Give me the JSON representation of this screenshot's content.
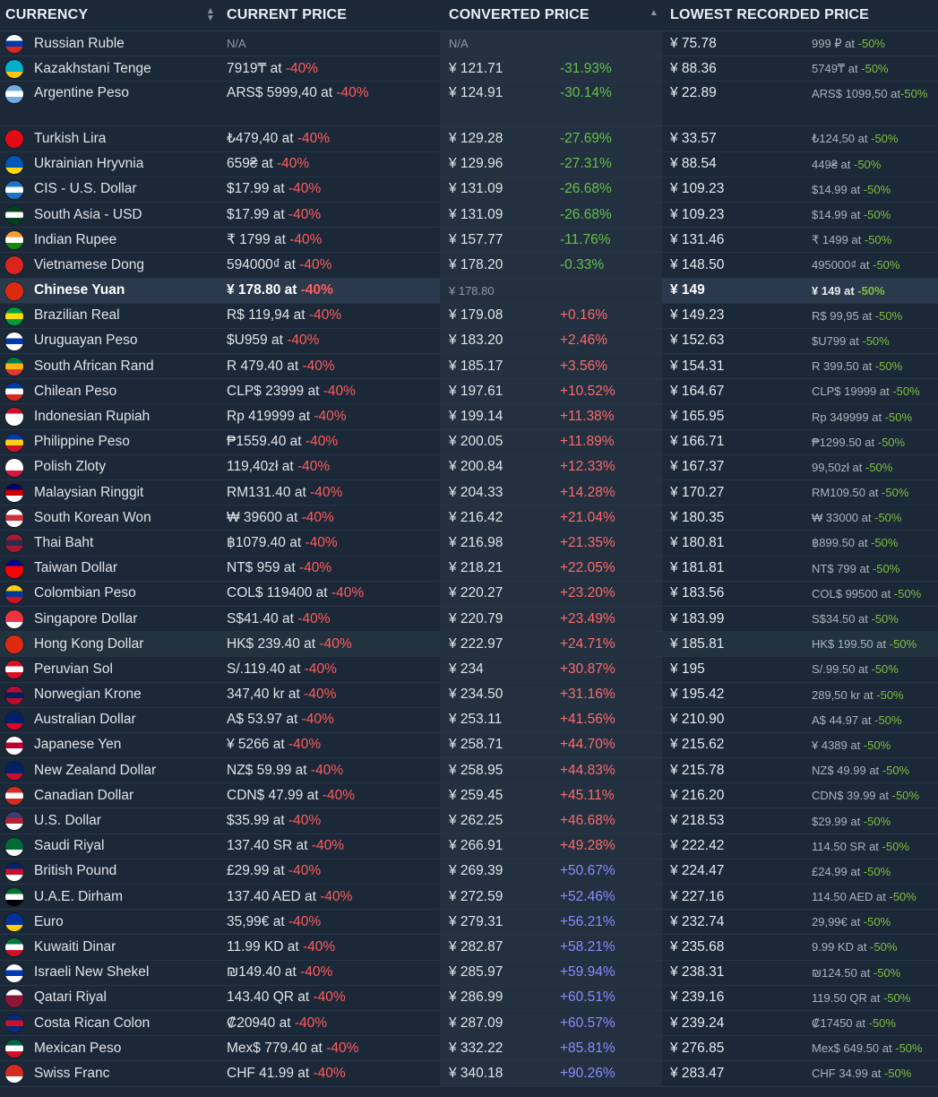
{
  "header": {
    "currency": "CURRENCY",
    "current_price": "CURRENT PRICE",
    "converted_price": "CONVERTED PRICE",
    "lowest_recorded_price": "LOWEST RECORDED PRICE"
  },
  "rows": [
    {
      "name": "Russian Ruble",
      "price": "N/A",
      "discount": "",
      "conv": "N/A",
      "pct": "",
      "low": "¥ 75.78",
      "low_sub": "999 ₽ at",
      "low_disc": "-50%",
      "flag": [
        "#ffffff",
        "#0039a6",
        "#d52b1e"
      ]
    },
    {
      "name": "Kazakhstani Tenge",
      "price": "7919₸ at",
      "discount": "-40%",
      "conv": "¥ 121.71",
      "pct": "-31.93%",
      "low": "¥ 88.36",
      "low_sub": "5749₸ at",
      "low_disc": "-50%",
      "flag": [
        "#00afca",
        "#00afca",
        "#fec50c"
      ]
    },
    {
      "name": "Argentine Peso",
      "price": "ARS$ 5999,40 at",
      "discount": "-40%",
      "conv": "¥ 124.91",
      "pct": "-30.14%",
      "low": "¥ 22.89",
      "low_sub": "ARS$ 1099,50 at",
      "low_disc": "-50%",
      "flag": [
        "#74acdf",
        "#ffffff",
        "#74acdf"
      ]
    },
    {
      "name": "Turkish Lira",
      "price": "₺479,40 at",
      "discount": "-40%",
      "conv": "¥ 129.28",
      "pct": "-27.69%",
      "low": "¥ 33.57",
      "low_sub": "₺124,50 at",
      "low_disc": "-50%",
      "flag": [
        "#e30a17",
        "#e30a17",
        "#e30a17"
      ]
    },
    {
      "name": "Ukrainian Hryvnia",
      "price": "659₴ at",
      "discount": "-40%",
      "conv": "¥ 129.96",
      "pct": "-27.31%",
      "low": "¥ 88.54",
      "low_sub": "449₴ at",
      "low_disc": "-50%",
      "flag": [
        "#0057b7",
        "#0057b7",
        "#ffd700"
      ]
    },
    {
      "name": "CIS - U.S. Dollar",
      "price": "$17.99 at",
      "discount": "-40%",
      "conv": "¥ 131.09",
      "pct": "-26.68%",
      "low": "¥ 109.23",
      "low_sub": "$14.99 at",
      "low_disc": "-50%",
      "flag": [
        "#1a73c9",
        "#ffffff",
        "#1a73c9"
      ]
    },
    {
      "name": "South Asia - USD",
      "price": "$17.99 at",
      "discount": "-40%",
      "conv": "¥ 131.09",
      "pct": "-26.68%",
      "low": "¥ 109.23",
      "low_sub": "$14.99 at",
      "low_disc": "-50%",
      "flag": [
        "#01411c",
        "#ffffff",
        "#01411c"
      ]
    },
    {
      "name": "Indian Rupee",
      "price": "₹ 1799 at",
      "discount": "-40%",
      "conv": "¥ 157.77",
      "pct": "-11.76%",
      "low": "¥ 131.46",
      "low_sub": "₹ 1499 at",
      "low_disc": "-50%",
      "flag": [
        "#ff9933",
        "#ffffff",
        "#138808"
      ]
    },
    {
      "name": "Vietnamese Dong",
      "price": "594000₫ at",
      "discount": "-40%",
      "conv": "¥ 178.20",
      "pct": "-0.33%",
      "low": "¥ 148.50",
      "low_sub": "495000₫ at",
      "low_disc": "-50%",
      "flag": [
        "#da251d",
        "#da251d",
        "#da251d"
      ]
    },
    {
      "name": "Chinese Yuan",
      "price": "¥ 178.80 at",
      "discount": "-40%",
      "conv": "¥ 178.80",
      "pct": "",
      "low": "¥ 149",
      "low_sub": "¥ 149 at",
      "low_disc": "-50%",
      "flag": [
        "#de2910",
        "#de2910",
        "#de2910"
      ]
    },
    {
      "name": "Brazilian Real",
      "price": "R$ 119,94 at",
      "discount": "-40%",
      "conv": "¥ 179.08",
      "pct": "+0.16%",
      "low": "¥ 149.23",
      "low_sub": "R$ 99,95 at",
      "low_disc": "-50%",
      "flag": [
        "#009c3b",
        "#ffdf00",
        "#009c3b"
      ]
    },
    {
      "name": "Uruguayan Peso",
      "price": "$U959 at",
      "discount": "-40%",
      "conv": "¥ 183.20",
      "pct": "+2.46%",
      "low": "¥ 152.63",
      "low_sub": "$U799 at",
      "low_disc": "-50%",
      "flag": [
        "#ffffff",
        "#0038a8",
        "#ffffff"
      ]
    },
    {
      "name": "South African Rand",
      "price": "R 479.40 at",
      "discount": "-40%",
      "conv": "¥ 185.17",
      "pct": "+3.56%",
      "low": "¥ 154.31",
      "low_sub": "R 399.50 at",
      "low_disc": "-50%",
      "flag": [
        "#007a4d",
        "#ffb612",
        "#de3831"
      ]
    },
    {
      "name": "Chilean Peso",
      "price": "CLP$ 23999 at",
      "discount": "-40%",
      "conv": "¥ 197.61",
      "pct": "+10.52%",
      "low": "¥ 164.67",
      "low_sub": "CLP$ 19999 at",
      "low_disc": "-50%",
      "flag": [
        "#0039a6",
        "#ffffff",
        "#d52b1e"
      ]
    },
    {
      "name": "Indonesian Rupiah",
      "price": "Rp 419999 at",
      "discount": "-40%",
      "conv": "¥ 199.14",
      "pct": "+11.38%",
      "low": "¥ 165.95",
      "low_sub": "Rp 349999 at",
      "low_disc": "-50%",
      "flag": [
        "#ce1126",
        "#ffffff",
        "#ffffff"
      ]
    },
    {
      "name": "Philippine Peso",
      "price": "₱1559.40 at",
      "discount": "-40%",
      "conv": "¥ 200.05",
      "pct": "+11.89%",
      "low": "¥ 166.71",
      "low_sub": "₱1299.50 at",
      "low_disc": "-50%",
      "flag": [
        "#0038a8",
        "#fcd116",
        "#ce1126"
      ]
    },
    {
      "name": "Polish Zloty",
      "price": "119,40zł at",
      "discount": "-40%",
      "conv": "¥ 200.84",
      "pct": "+12.33%",
      "low": "¥ 167.37",
      "low_sub": "99,50zł at",
      "low_disc": "-50%",
      "flag": [
        "#ffffff",
        "#ffffff",
        "#dc143c"
      ]
    },
    {
      "name": "Malaysian Ringgit",
      "price": "RM131.40 at",
      "discount": "-40%",
      "conv": "¥ 204.33",
      "pct": "+14.28%",
      "low": "¥ 170.27",
      "low_sub": "RM109.50 at",
      "low_disc": "-50%",
      "flag": [
        "#010066",
        "#cc0001",
        "#ffffff"
      ]
    },
    {
      "name": "South Korean Won",
      "price": "₩ 39600 at",
      "discount": "-40%",
      "conv": "¥ 216.42",
      "pct": "+21.04%",
      "low": "¥ 180.35",
      "low_sub": "₩ 33000 at",
      "low_disc": "-50%",
      "flag": [
        "#ffffff",
        "#cd2e3a",
        "#ffffff"
      ]
    },
    {
      "name": "Thai Baht",
      "price": "฿1079.40 at",
      "discount": "-40%",
      "conv": "¥ 216.98",
      "pct": "+21.35%",
      "low": "¥ 180.81",
      "low_sub": "฿899.50 at",
      "low_disc": "-50%",
      "flag": [
        "#a51931",
        "#2d2a4a",
        "#a51931"
      ]
    },
    {
      "name": "Taiwan Dollar",
      "price": "NT$ 959 at",
      "discount": "-40%",
      "conv": "¥ 218.21",
      "pct": "+22.05%",
      "low": "¥ 181.81",
      "low_sub": "NT$ 799 at",
      "low_disc": "-50%",
      "flag": [
        "#000095",
        "#fe0000",
        "#fe0000"
      ]
    },
    {
      "name": "Colombian Peso",
      "price": "COL$ 119400 at",
      "discount": "-40%",
      "conv": "¥ 220.27",
      "pct": "+23.20%",
      "low": "¥ 183.56",
      "low_sub": "COL$ 99500 at",
      "low_disc": "-50%",
      "flag": [
        "#fcd116",
        "#003893",
        "#ce1126"
      ]
    },
    {
      "name": "Singapore Dollar",
      "price": "S$41.40 at",
      "discount": "-40%",
      "conv": "¥ 220.79",
      "pct": "+23.49%",
      "low": "¥ 183.99",
      "low_sub": "S$34.50 at",
      "low_disc": "-50%",
      "flag": [
        "#ef3340",
        "#ef3340",
        "#ffffff"
      ]
    },
    {
      "name": "Hong Kong Dollar",
      "price": "HK$ 239.40 at",
      "discount": "-40%",
      "conv": "¥ 222.97",
      "pct": "+24.71%",
      "low": "¥ 185.81",
      "low_sub": "HK$ 199.50 at",
      "low_disc": "-50%",
      "flag": [
        "#de2910",
        "#de2910",
        "#de2910"
      ]
    },
    {
      "name": "Peruvian Sol",
      "price": "S/.119.40 at",
      "discount": "-40%",
      "conv": "¥ 234",
      "pct": "+30.87%",
      "low": "¥ 195",
      "low_sub": "S/.99.50 at",
      "low_disc": "-50%",
      "flag": [
        "#d91023",
        "#ffffff",
        "#d91023"
      ]
    },
    {
      "name": "Norwegian Krone",
      "price": "347,40 kr at",
      "discount": "-40%",
      "conv": "¥ 234.50",
      "pct": "+31.16%",
      "low": "¥ 195.42",
      "low_sub": "289,50 kr at",
      "low_disc": "-50%",
      "flag": [
        "#ba0c2f",
        "#00205b",
        "#ba0c2f"
      ]
    },
    {
      "name": "Australian Dollar",
      "price": "A$ 53.97 at",
      "discount": "-40%",
      "conv": "¥ 253.11",
      "pct": "+41.56%",
      "low": "¥ 210.90",
      "low_sub": "A$ 44.97 at",
      "low_disc": "-50%",
      "flag": [
        "#012169",
        "#012169",
        "#e4002b"
      ]
    },
    {
      "name": "Japanese Yen",
      "price": "¥ 5266 at",
      "discount": "-40%",
      "conv": "¥ 258.71",
      "pct": "+44.70%",
      "low": "¥ 215.62",
      "low_sub": "¥ 4389 at",
      "low_disc": "-50%",
      "flag": [
        "#ffffff",
        "#bc002d",
        "#ffffff"
      ]
    },
    {
      "name": "New Zealand Dollar",
      "price": "NZ$ 59.99 at",
      "discount": "-40%",
      "conv": "¥ 258.95",
      "pct": "+44.83%",
      "low": "¥ 215.78",
      "low_sub": "NZ$ 49.99 at",
      "low_disc": "-50%",
      "flag": [
        "#012169",
        "#012169",
        "#c8102e"
      ]
    },
    {
      "name": "Canadian Dollar",
      "price": "CDN$ 47.99 at",
      "discount": "-40%",
      "conv": "¥ 259.45",
      "pct": "+45.11%",
      "low": "¥ 216.20",
      "low_sub": "CDN$ 39.99 at",
      "low_disc": "-50%",
      "flag": [
        "#d52b1e",
        "#ffffff",
        "#d52b1e"
      ]
    },
    {
      "name": "U.S. Dollar",
      "price": "$35.99 at",
      "discount": "-40%",
      "conv": "¥ 262.25",
      "pct": "+46.68%",
      "low": "¥ 218.53",
      "low_sub": "$29.99 at",
      "low_disc": "-50%",
      "flag": [
        "#3c3b6e",
        "#b22234",
        "#ffffff"
      ]
    },
    {
      "name": "Saudi Riyal",
      "price": "137.40 SR at",
      "discount": "-40%",
      "conv": "¥ 266.91",
      "pct": "+49.28%",
      "low": "¥ 222.42",
      "low_sub": "114.50 SR at",
      "low_disc": "-50%",
      "flag": [
        "#006c35",
        "#006c35",
        "#ffffff"
      ]
    },
    {
      "name": "British Pound",
      "price": "£29.99 at",
      "discount": "-40%",
      "conv": "¥ 269.39",
      "pct": "+50.67%",
      "low": "¥ 224.47",
      "low_sub": "£24.99 at",
      "low_disc": "-50%",
      "flag": [
        "#012169",
        "#c8102e",
        "#ffffff"
      ]
    },
    {
      "name": "U.A.E. Dirham",
      "price": "137.40 AED at",
      "discount": "-40%",
      "conv": "¥ 272.59",
      "pct": "+52.46%",
      "low": "¥ 227.16",
      "low_sub": "114.50 AED at",
      "low_disc": "-50%",
      "flag": [
        "#00732f",
        "#ffffff",
        "#000000"
      ]
    },
    {
      "name": "Euro",
      "price": "35,99€ at",
      "discount": "-40%",
      "conv": "¥ 279.31",
      "pct": "+56.21%",
      "low": "¥ 232.74",
      "low_sub": "29,99€ at",
      "low_disc": "-50%",
      "flag": [
        "#003399",
        "#003399",
        "#ffcc00"
      ]
    },
    {
      "name": "Kuwaiti Dinar",
      "price": "11.99 KD at",
      "discount": "-40%",
      "conv": "¥ 282.87",
      "pct": "+58.21%",
      "low": "¥ 235.68",
      "low_sub": "9.99 KD at",
      "low_disc": "-50%",
      "flag": [
        "#007a3d",
        "#ffffff",
        "#ce1126"
      ]
    },
    {
      "name": "Israeli New Shekel",
      "price": "₪149.40 at",
      "discount": "-40%",
      "conv": "¥ 285.97",
      "pct": "+59.94%",
      "low": "¥ 238.31",
      "low_sub": "₪124.50 at",
      "low_disc": "-50%",
      "flag": [
        "#ffffff",
        "#0038b8",
        "#ffffff"
      ]
    },
    {
      "name": "Qatari Riyal",
      "price": "143.40 QR at",
      "discount": "-40%",
      "conv": "¥ 286.99",
      "pct": "+60.51%",
      "low": "¥ 239.16",
      "low_sub": "119.50 QR at",
      "low_disc": "-50%",
      "flag": [
        "#ffffff",
        "#8a1538",
        "#8a1538"
      ]
    },
    {
      "name": "Costa Rican Colon",
      "price": "₡20940 at",
      "discount": "-40%",
      "conv": "¥ 287.09",
      "pct": "+60.57%",
      "low": "¥ 239.24",
      "low_sub": "₡17450 at",
      "low_disc": "-50%",
      "flag": [
        "#002b7f",
        "#ce1126",
        "#002b7f"
      ]
    },
    {
      "name": "Mexican Peso",
      "price": "Mex$ 779.40 at",
      "discount": "-40%",
      "conv": "¥ 332.22",
      "pct": "+85.81%",
      "low": "¥ 276.85",
      "low_sub": "Mex$ 649.50 at",
      "low_disc": "-50%",
      "flag": [
        "#006847",
        "#ffffff",
        "#ce1126"
      ]
    },
    {
      "name": "Swiss Franc",
      "price": "CHF 41.99 at",
      "discount": "-40%",
      "conv": "¥ 340.18",
      "pct": "+90.26%",
      "low": "¥ 283.47",
      "low_sub": "CHF 34.99 at",
      "low_disc": "-50%",
      "flag": [
        "#d52b1e",
        "#d52b1e",
        "#ffffff"
      ]
    }
  ]
}
